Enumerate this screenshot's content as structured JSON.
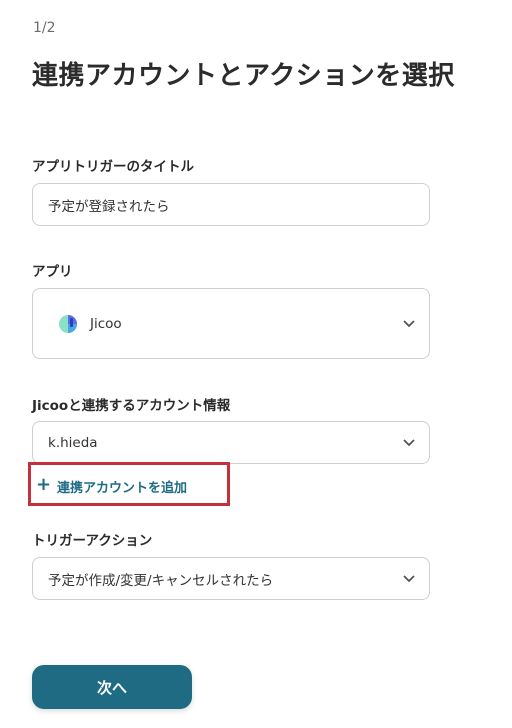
{
  "header": {
    "step": "1/2",
    "title": "連携アカウントとアクションを選択"
  },
  "trigger_title": {
    "label": "アプリトリガーのタイトル",
    "value": "予定が登録されたら"
  },
  "app": {
    "label": "アプリ",
    "value": "Jicoo",
    "icon": "jicoo-logo-icon"
  },
  "account": {
    "label": "Jicooと連携するアカウント情報",
    "value": "k.hieda",
    "add_link": "連携アカウントを追加",
    "add_icon": "plus-icon"
  },
  "trigger_action": {
    "label": "トリガーアクション",
    "value": "予定が作成/変更/キャンセルされたら"
  },
  "footer": {
    "next_button": "次へ"
  },
  "colors": {
    "accent": "#1f6b84",
    "highlight_box": "#c4313a",
    "border": "#cfcfcf"
  }
}
